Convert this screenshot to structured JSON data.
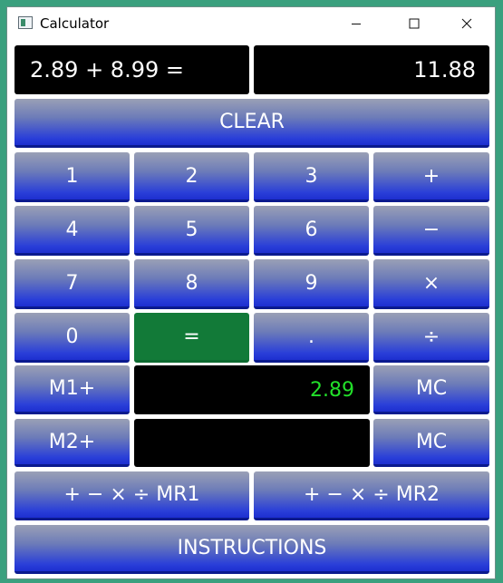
{
  "window": {
    "title": "Calculator"
  },
  "display": {
    "expression": "2.89 + 8.99 =",
    "result": "11.88"
  },
  "buttons": {
    "clear": "CLEAR",
    "one": "1",
    "two": "2",
    "three": "3",
    "plus": "+",
    "four": "4",
    "five": "5",
    "six": "6",
    "minus": "−",
    "seven": "7",
    "eight": "8",
    "nine": "9",
    "multiply": "×",
    "zero": "0",
    "equals": "=",
    "decimal": ".",
    "divide": "÷",
    "m1plus": "M1+",
    "mc1": "MC",
    "m2plus": "M2+",
    "mc2": "MC",
    "mr1": "+ − × ÷ MR1",
    "mr2": "+ − × ÷ MR2",
    "instructions": "INSTRUCTIONS"
  },
  "memory": {
    "m1_value": "2.89",
    "m2_value": ""
  },
  "colors": {
    "button_gradient_bottom": "#1d2fd0",
    "equals_green": "#127a38",
    "memory_text": "#22e02a"
  }
}
